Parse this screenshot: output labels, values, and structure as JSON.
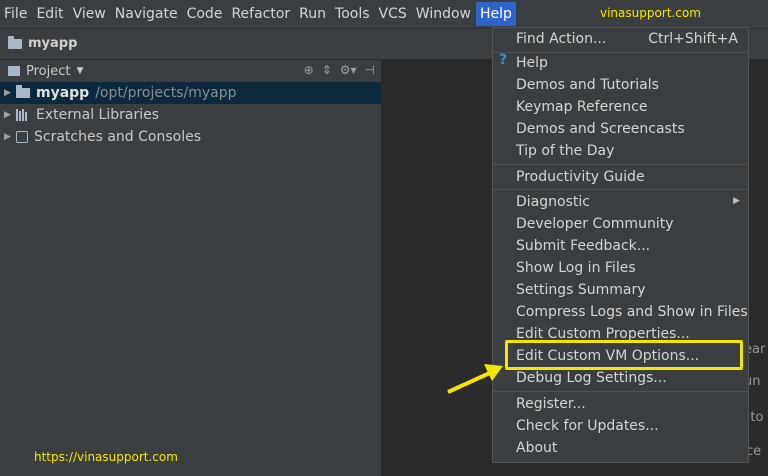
{
  "menubar": {
    "items": [
      "File",
      "Edit",
      "View",
      "Navigate",
      "Code",
      "Refactor",
      "Run",
      "Tools",
      "VCS",
      "Window",
      "Help"
    ],
    "active_index": 10,
    "watermark": "vinasupport.com"
  },
  "navbar": {
    "breadcrumb": "myapp"
  },
  "project": {
    "header_title": "Project",
    "tree": [
      {
        "label": "myapp",
        "path": "/opt/projects/myapp",
        "selected": true
      },
      {
        "label": "External Libraries"
      },
      {
        "label": "Scratches and Consoles"
      }
    ]
  },
  "watermark_bottom": "https://vinasupport.com",
  "editor_peek": [
    "ear",
    "un",
    "p to",
    "ece"
  ],
  "help_menu": {
    "find_action": {
      "label": "Find Action...",
      "shortcut": "Ctrl+Shift+A"
    },
    "group1": [
      "Help",
      "Demos and Tutorials",
      "Keymap Reference",
      "Demos and Screencasts",
      "Tip of the Day"
    ],
    "group2": [
      "Productivity Guide"
    ],
    "group3": [
      "Diagnostic",
      "Developer Community",
      "Submit Feedback...",
      "Show Log in Files",
      "Settings Summary",
      "Compress Logs and Show in Files",
      "Edit Custom Properties...",
      "Edit Custom VM Options...",
      "Debug Log Settings..."
    ],
    "group4": [
      "Register...",
      "Check for Updates...",
      "About"
    ],
    "highlight_color": "#f5e600"
  }
}
